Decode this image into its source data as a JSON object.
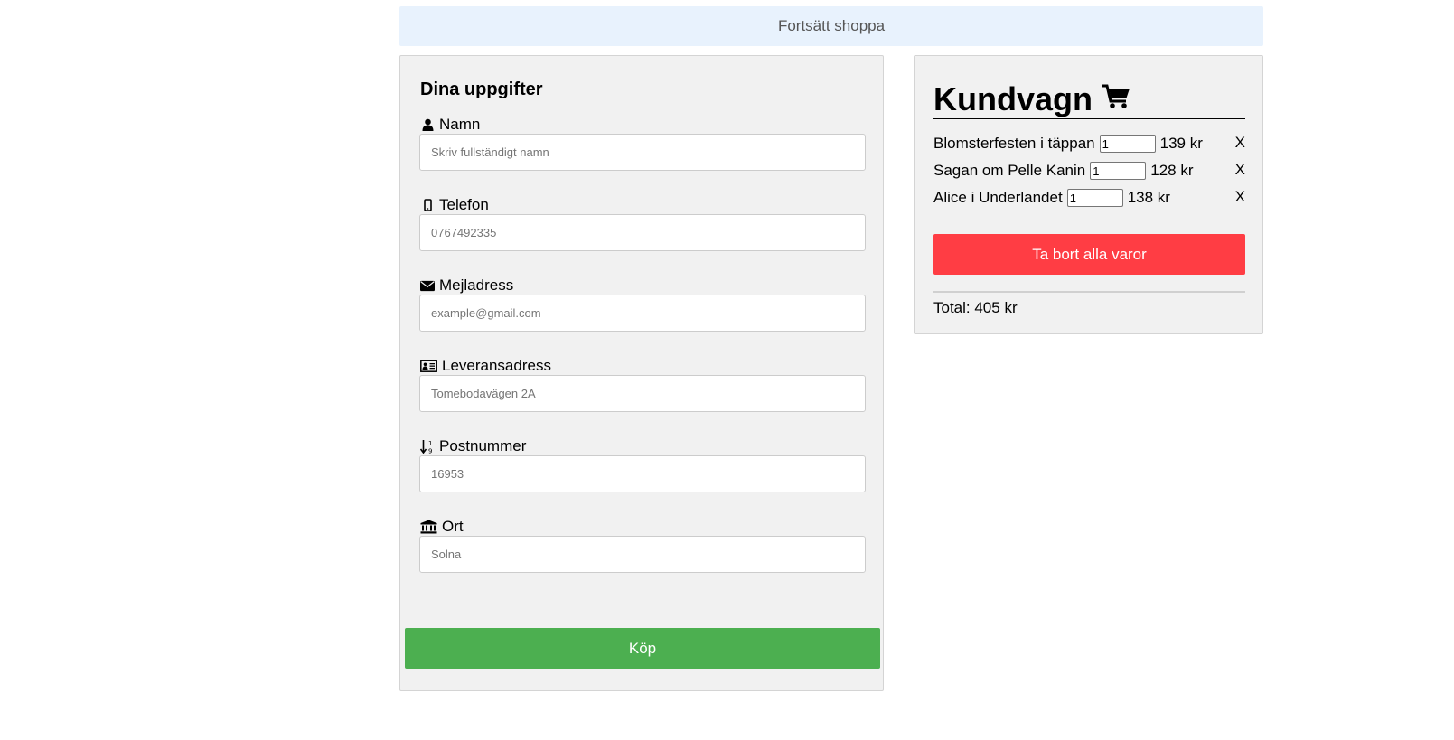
{
  "top_bar": {
    "continue_label": "Fortsätt shoppa"
  },
  "form": {
    "title": "Dina uppgifter",
    "fields": [
      {
        "label": "Namn",
        "icon": "user-icon",
        "value": "",
        "placeholder": "Skriv fullständigt namn"
      },
      {
        "label": "Telefon",
        "icon": "mobile-phone-icon",
        "value": "",
        "placeholder": "0767492335"
      },
      {
        "label": "Mejladress",
        "icon": "envelope-icon",
        "value": "",
        "placeholder": "example@gmail.com"
      },
      {
        "label": "Leveransadress",
        "icon": "address-card-icon",
        "value": "",
        "placeholder": "Tomebodavägen 2A"
      },
      {
        "label": "Postnummer",
        "icon": "sort-numeric-icon",
        "value": "",
        "placeholder": "16953"
      },
      {
        "label": "Ort",
        "icon": "bank-icon",
        "value": "",
        "placeholder": "Solna"
      }
    ],
    "buy_label": "Köp"
  },
  "cart": {
    "title": "Kundvagn",
    "icon": "shopping-cart-icon",
    "items": [
      {
        "name": "Blomsterfesten i täppan",
        "quantity": "1",
        "price": "139 kr",
        "remove_label": "X"
      },
      {
        "name": "Sagan om Pelle Kanin",
        "quantity": "1",
        "price": "128 kr",
        "remove_label": "X"
      },
      {
        "name": "Alice i Underlandet",
        "quantity": "1",
        "price": "138 kr",
        "remove_label": "X"
      }
    ],
    "clear_label": "Ta bort alla varor",
    "total": "Total: 405 kr"
  },
  "colors": {
    "continue_bg": "#e8f2fd",
    "panel_bg": "#f1f1f1",
    "buy_button": "#4caf50",
    "clear_button": "#ff3d44"
  }
}
